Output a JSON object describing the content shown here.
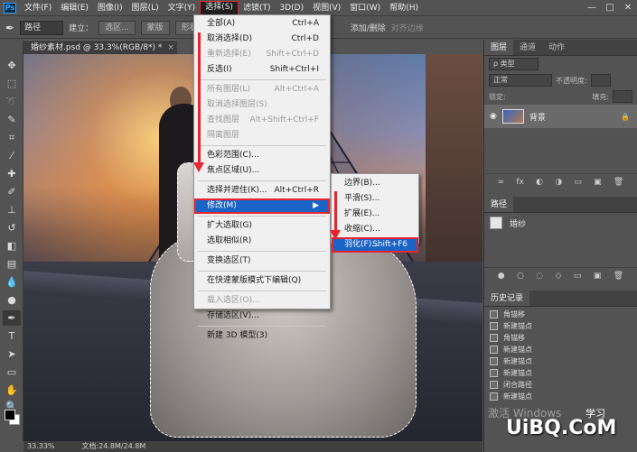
{
  "menubar": {
    "logo": "Ps",
    "items": [
      "文件(F)",
      "编辑(E)",
      "图像(I)",
      "图层(L)",
      "文字(Y)",
      "选择(S)",
      "滤镜(T)",
      "3D(D)",
      "视图(V)",
      "窗口(W)",
      "帮助(H)"
    ],
    "active_index": 5,
    "window_controls": [
      "—",
      "□",
      "✕"
    ]
  },
  "options_bar": {
    "tool_mode": "路径",
    "build_label": "建立：",
    "select_btn": "选区...",
    "mask_btn": "蒙版",
    "shape_btn": "形状",
    "auto_add_delete": "添加/删除",
    "align_edges": "对齐边缘"
  },
  "document_tab": {
    "title": "婚纱素材.psd @ 33.3%(RGB/8*) *",
    "close": "×"
  },
  "select_menu": {
    "items": [
      {
        "label": "全部(A)",
        "shortcut": "Ctrl+A",
        "state": "normal"
      },
      {
        "label": "取消选择(D)",
        "shortcut": "Ctrl+D",
        "state": "normal"
      },
      {
        "label": "重新选择(E)",
        "shortcut": "Shift+Ctrl+D",
        "state": "disabled"
      },
      {
        "label": "反选(I)",
        "shortcut": "Shift+Ctrl+I",
        "state": "normal"
      },
      {
        "label": "所有图层(L)",
        "shortcut": "Alt+Ctrl+A",
        "state": "disabled"
      },
      {
        "label": "取消选择图层(S)",
        "shortcut": "",
        "state": "disabled"
      },
      {
        "label": "查找图层",
        "shortcut": "Alt+Shift+Ctrl+F",
        "state": "disabled"
      },
      {
        "label": "隔离图层",
        "shortcut": "",
        "state": "disabled"
      },
      {
        "label": "色彩范围(C)...",
        "shortcut": "",
        "state": "normal"
      },
      {
        "label": "焦点区域(U)...",
        "shortcut": "",
        "state": "normal"
      },
      {
        "label": "选择并遮住(K)...",
        "shortcut": "Alt+Ctrl+R",
        "state": "normal"
      },
      {
        "label": "修改(M)",
        "shortcut": "",
        "state": "highlighted"
      },
      {
        "label": "扩大选取(G)",
        "shortcut": "",
        "state": "normal"
      },
      {
        "label": "选取相似(R)",
        "shortcut": "",
        "state": "normal"
      },
      {
        "label": "变换选区(T)",
        "shortcut": "",
        "state": "normal"
      },
      {
        "label": "在快速蒙版模式下编辑(Q)",
        "shortcut": "",
        "state": "normal"
      },
      {
        "label": "载入选区(O)...",
        "shortcut": "",
        "state": "disabled"
      },
      {
        "label": "存储选区(V)...",
        "shortcut": "",
        "state": "normal"
      },
      {
        "label": "新建 3D 模型(3)",
        "shortcut": "",
        "state": "normal"
      }
    ],
    "submenu_arrow": "▶"
  },
  "modify_submenu": {
    "items": [
      {
        "label": "边界(B)...",
        "shortcut": "",
        "state": "normal"
      },
      {
        "label": "平滑(S)...",
        "shortcut": "",
        "state": "normal"
      },
      {
        "label": "扩展(E)...",
        "shortcut": "",
        "state": "normal"
      },
      {
        "label": "收缩(C)...",
        "shortcut": "",
        "state": "normal"
      },
      {
        "label": "羽化(F)...",
        "shortcut": "Shift+F6",
        "state": "highlighted"
      }
    ]
  },
  "layers_panel": {
    "tabs": [
      "图层",
      "通道",
      "动作"
    ],
    "active_tab": 0,
    "kind_filter": "ρ 类型",
    "blend_mode": "正常",
    "opacity_label": "不透明度:",
    "lock_label": "锁定:",
    "fill_label": "填充:",
    "layer_name": "背景",
    "eye": "◉",
    "lock_icon": "🔒",
    "buttons": [
      "∞",
      "fx",
      "◐",
      "◑",
      "▭",
      "▣",
      "🗑"
    ]
  },
  "paths_panel": {
    "tab": "路径",
    "path_name": "婚纱",
    "buttons": [
      "●",
      "○",
      "◌",
      "◇",
      "▭",
      "▣",
      "🗑"
    ]
  },
  "history_panel": {
    "tab": "历史记录",
    "items": [
      "角锚移",
      "新建锚点",
      "角锚移",
      "新建锚点",
      "新建锚点",
      "新建锚点",
      "闭合路径",
      "新建锚点"
    ]
  },
  "status_bar": {
    "zoom": "33.33%",
    "doc_info": "文档:24.8M/24.8M"
  },
  "watermark": {
    "activate": "激活 Windows",
    "site": "UiBQ.CoM",
    "brand_text": "学习"
  },
  "colors": {
    "highlight_blue": "#1a63c7",
    "annotation_red": "#e8252f",
    "ui_dark": "#535353"
  }
}
